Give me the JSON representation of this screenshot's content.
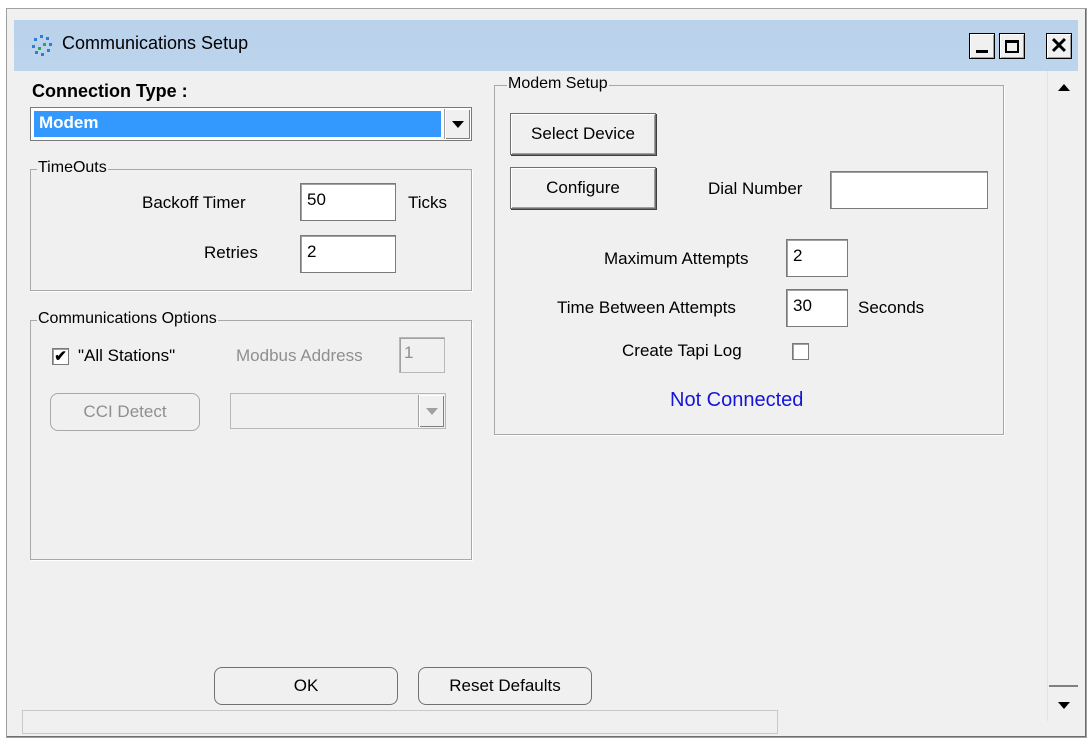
{
  "window": {
    "title": "Communications Setup",
    "controls": {
      "minimize": "_",
      "maximize": "□",
      "close": "×"
    }
  },
  "connection": {
    "label": "Connection Type :",
    "selected": "Modem"
  },
  "timeouts": {
    "title": "TimeOuts",
    "backoff_label": "Backoff Timer",
    "backoff_value": "50",
    "backoff_unit": "Ticks",
    "retries_label": "Retries",
    "retries_value": "2"
  },
  "comm_options": {
    "title": "Communications Options",
    "all_stations_label": "\"All Stations\"",
    "all_stations_checked": "✔",
    "modbus_label": "Modbus Address",
    "modbus_value": "1",
    "cci_detect_label": "CCI Detect",
    "cci_select_value": ""
  },
  "modem": {
    "title": "Modem Setup",
    "select_device_label": "Select Device",
    "configure_label": "Configure",
    "dial_number_label": "Dial Number",
    "dial_number_value": "",
    "max_attempts_label": "Maximum Attempts",
    "max_attempts_value": "2",
    "time_between_label": "Time Between Attempts",
    "time_between_value": "30",
    "time_between_unit": "Seconds",
    "tapi_log_label": "Create Tapi Log",
    "tapi_log_checked": "",
    "status": "Not Connected",
    "status_color": "#1515d8"
  },
  "footer": {
    "ok_label": "OK",
    "reset_label": "Reset Defaults"
  },
  "colors": {
    "titlebar": "#b9d1ea",
    "selection": "#3399ff",
    "dialog_bg": "#f0f0f0"
  }
}
